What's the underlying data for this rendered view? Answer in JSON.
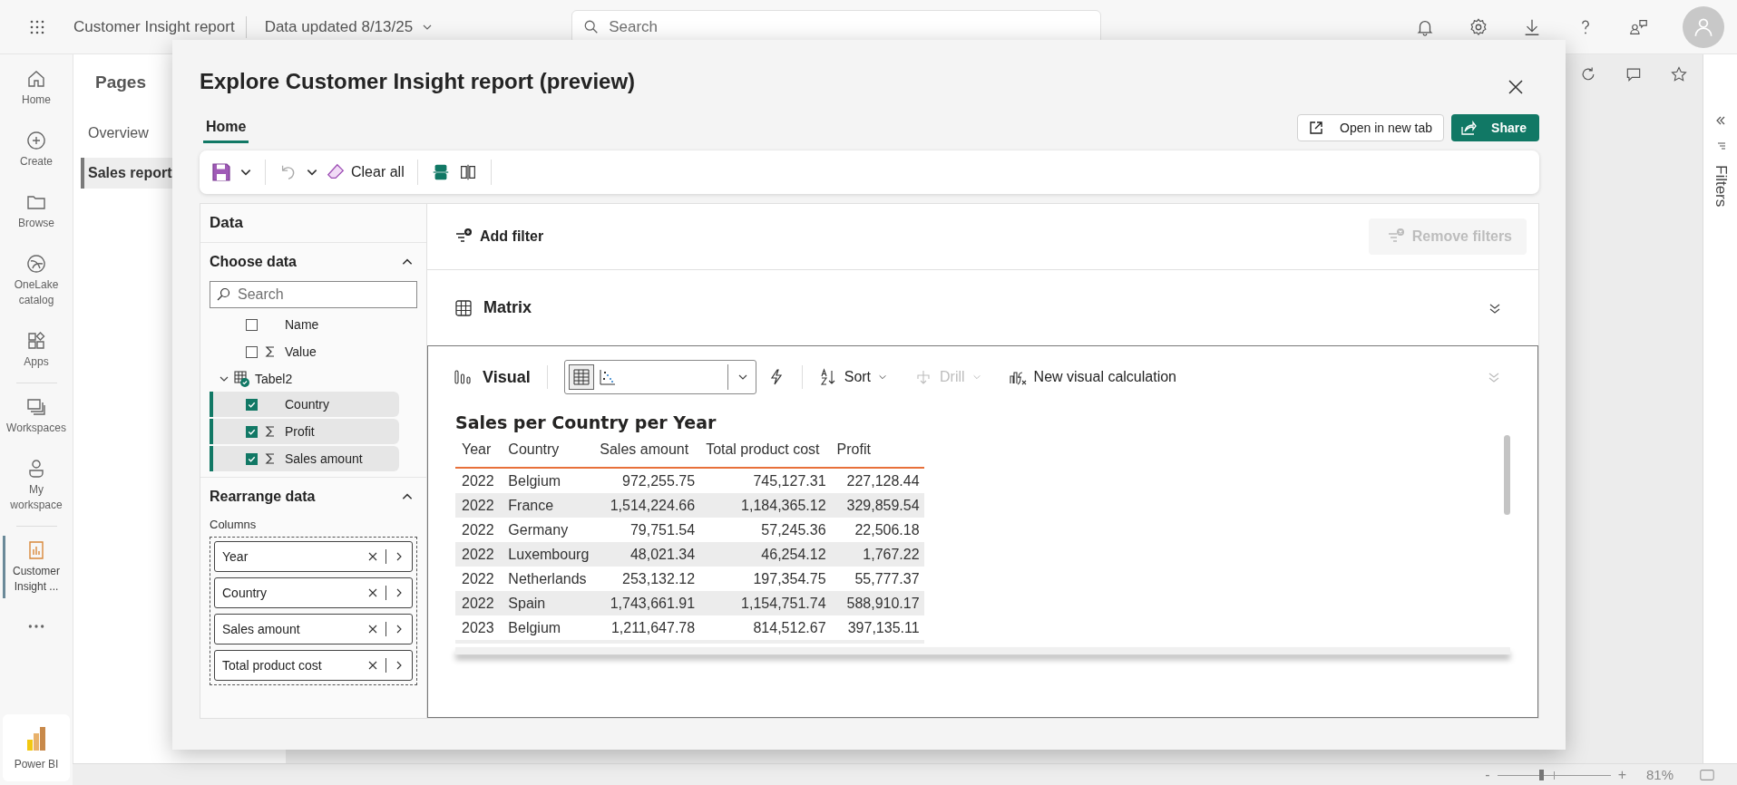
{
  "app_bar": {
    "report_name": "Customer Insight report",
    "data_updated": "Data updated 8/13/25",
    "search": {
      "placeholder": "Search"
    }
  },
  "nav": [
    {
      "label": "Home",
      "selected": false
    },
    {
      "label": "Create",
      "selected": false
    },
    {
      "label": "Browse",
      "selected": false
    },
    {
      "label": "OneLake catalog",
      "selected": false
    },
    {
      "label": "Apps",
      "selected": false
    },
    {
      "label": "Workspaces",
      "selected": false
    },
    {
      "label": "My workspace",
      "selected": false
    },
    {
      "label": "Customer Insight ...",
      "selected": true
    }
  ],
  "product": "Power BI",
  "pages": {
    "title": "Pages",
    "items": [
      {
        "label": "Overview",
        "selected": false
      },
      {
        "label": "Sales report",
        "selected": true
      }
    ]
  },
  "dialog": {
    "title": "Explore Customer Insight report (preview)",
    "tabs": [
      {
        "label": "Home",
        "selected": true
      }
    ],
    "open_new_tab": "Open in new tab",
    "share": "Share",
    "toolbar": {
      "clear_all": "Clear all"
    },
    "data_pane": {
      "title": "Data",
      "choose_title": "Choose data",
      "search_placeholder": "Search",
      "fields": [
        {
          "label": "Name",
          "checked": false,
          "measure": false
        },
        {
          "label": "Value",
          "checked": false,
          "measure": true
        }
      ],
      "table": {
        "label": "Tabel2",
        "expanded": true,
        "fields": [
          {
            "label": "Country",
            "checked": true,
            "measure": false
          },
          {
            "label": "Profit",
            "checked": true,
            "measure": true
          },
          {
            "label": "Sales amount",
            "checked": true,
            "measure": true
          }
        ]
      },
      "rearrange_title": "Rearrange data",
      "columns_label": "Columns",
      "columns": [
        "Year",
        "Country",
        "Sales amount",
        "Total product cost"
      ]
    },
    "filters": {
      "add": "Add filter",
      "remove": "Remove filters",
      "remove_disabled": true
    },
    "matrix": {
      "title": "Matrix"
    },
    "visual": {
      "title": "Visual",
      "sort": "Sort",
      "drill": "Drill",
      "drill_disabled": true,
      "new_calc": "New visual calculation",
      "table": {
        "title": "Sales per Country per Year",
        "columns": [
          "Year",
          "Country",
          "Sales amount",
          "Total product cost",
          "Profit"
        ],
        "rows": [
          [
            "2022",
            "Belgium",
            "972,255.75",
            "745,127.31",
            "227,128.44"
          ],
          [
            "2022",
            "France",
            "1,514,224.66",
            "1,184,365.12",
            "329,859.54"
          ],
          [
            "2022",
            "Germany",
            "79,751.54",
            "57,245.36",
            "22,506.18"
          ],
          [
            "2022",
            "Luxembourg",
            "48,021.34",
            "46,254.12",
            "1,767.22"
          ],
          [
            "2022",
            "Netherlands",
            "253,132.12",
            "197,354.75",
            "55,777.37"
          ],
          [
            "2022",
            "Spain",
            "1,743,661.91",
            "1,154,751.74",
            "588,910.17"
          ],
          [
            "2023",
            "Belgium",
            "1,211,647.78",
            "814,512.67",
            "397,135.11"
          ]
        ]
      }
    }
  },
  "filters_pane": {
    "title": "Filters"
  },
  "status_bar": {
    "zoom_out": "-",
    "zoom_in": "+",
    "zoom": {
      "level": 0.39
    },
    "zoom_text": "81%"
  }
}
